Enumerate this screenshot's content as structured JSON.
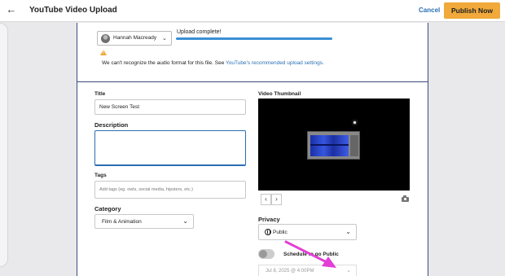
{
  "header": {
    "back_icon": "back-arrow-icon",
    "title": "YouTube Video Upload",
    "cancel_label": "Cancel",
    "publish_label": "Publish Now"
  },
  "account": {
    "name": "Hannah Macready",
    "avatar_icon": "user-avatar",
    "chevron_icon": "chevron-down-icon"
  },
  "upload": {
    "status": "Upload complete!",
    "progress": 1.0
  },
  "warning": {
    "icon": "warning-triangle-icon",
    "text": "We can't recognize the audio format for this file. See ",
    "link": "YouTube's recommended upload settings."
  },
  "form": {
    "title_label": "Title",
    "title_value": "New Screen Test",
    "description_label": "Description",
    "description_value": "",
    "tags_label": "Tags",
    "tags_placeholder": "Add tags (eg. owls, social media, hipsters, etc.)",
    "category_label": "Category",
    "category_value": "Film & Animation"
  },
  "thumbnail": {
    "label": "Video Thumbnail",
    "prev_icon": "chevron-left-icon",
    "next_icon": "chevron-right-icon",
    "camera_icon": "camera-icon"
  },
  "privacy": {
    "label": "Privacy",
    "value": "Public",
    "icon": "globe-icon",
    "schedule_label": "Schedule to go Public",
    "schedule_enabled": false,
    "schedule_date": "Jul 8, 2025 @ 4:00PM"
  },
  "colors": {
    "accent": "#f0a93a",
    "link": "#2a6fb3",
    "progress": "#3b8fd6",
    "annotation_arrow": "#e33fd6"
  }
}
